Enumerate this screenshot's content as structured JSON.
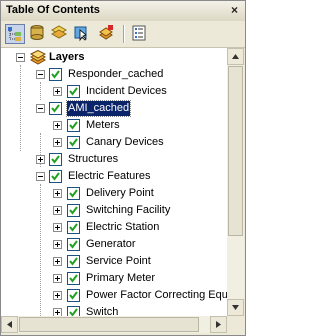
{
  "window": {
    "title": "Table Of Contents",
    "close_glyph": "×"
  },
  "toolbar": {
    "buttons": [
      {
        "icon": "list-by-drawing-order-icon"
      },
      {
        "icon": "list-by-source-icon"
      },
      {
        "icon": "list-by-visibility-icon"
      },
      {
        "icon": "list-by-selection-icon"
      },
      {
        "icon": "add-data-icon"
      },
      {
        "icon": "options-icon"
      }
    ]
  },
  "tree": {
    "root": "Layers",
    "items": [
      {
        "label": "Responder_cached",
        "expanded": true,
        "checked": true
      },
      {
        "label": "Incident Devices",
        "expanded": false,
        "checked": true
      },
      {
        "label": "AMI_cached",
        "expanded": true,
        "checked": true,
        "selected": true
      },
      {
        "label": "Meters",
        "expanded": false,
        "checked": true
      },
      {
        "label": "Canary Devices",
        "expanded": false,
        "checked": true
      },
      {
        "label": "Structures",
        "expanded": false,
        "checked": true
      },
      {
        "label": "Electric Features",
        "expanded": true,
        "checked": true
      },
      {
        "label": "Delivery Point",
        "expanded": false,
        "checked": true
      },
      {
        "label": "Switching Facility",
        "expanded": false,
        "checked": true
      },
      {
        "label": "Electric Station",
        "expanded": false,
        "checked": true
      },
      {
        "label": "Generator",
        "expanded": false,
        "checked": true
      },
      {
        "label": "Service Point",
        "expanded": false,
        "checked": true
      },
      {
        "label": "Primary Meter",
        "expanded": false,
        "checked": true
      },
      {
        "label": "Power Factor Correcting Equ",
        "expanded": false,
        "checked": true
      },
      {
        "label": "Switch",
        "expanded": false,
        "checked": true
      }
    ]
  },
  "colors": {
    "selection": "#0a246a",
    "check": "#21a121"
  }
}
